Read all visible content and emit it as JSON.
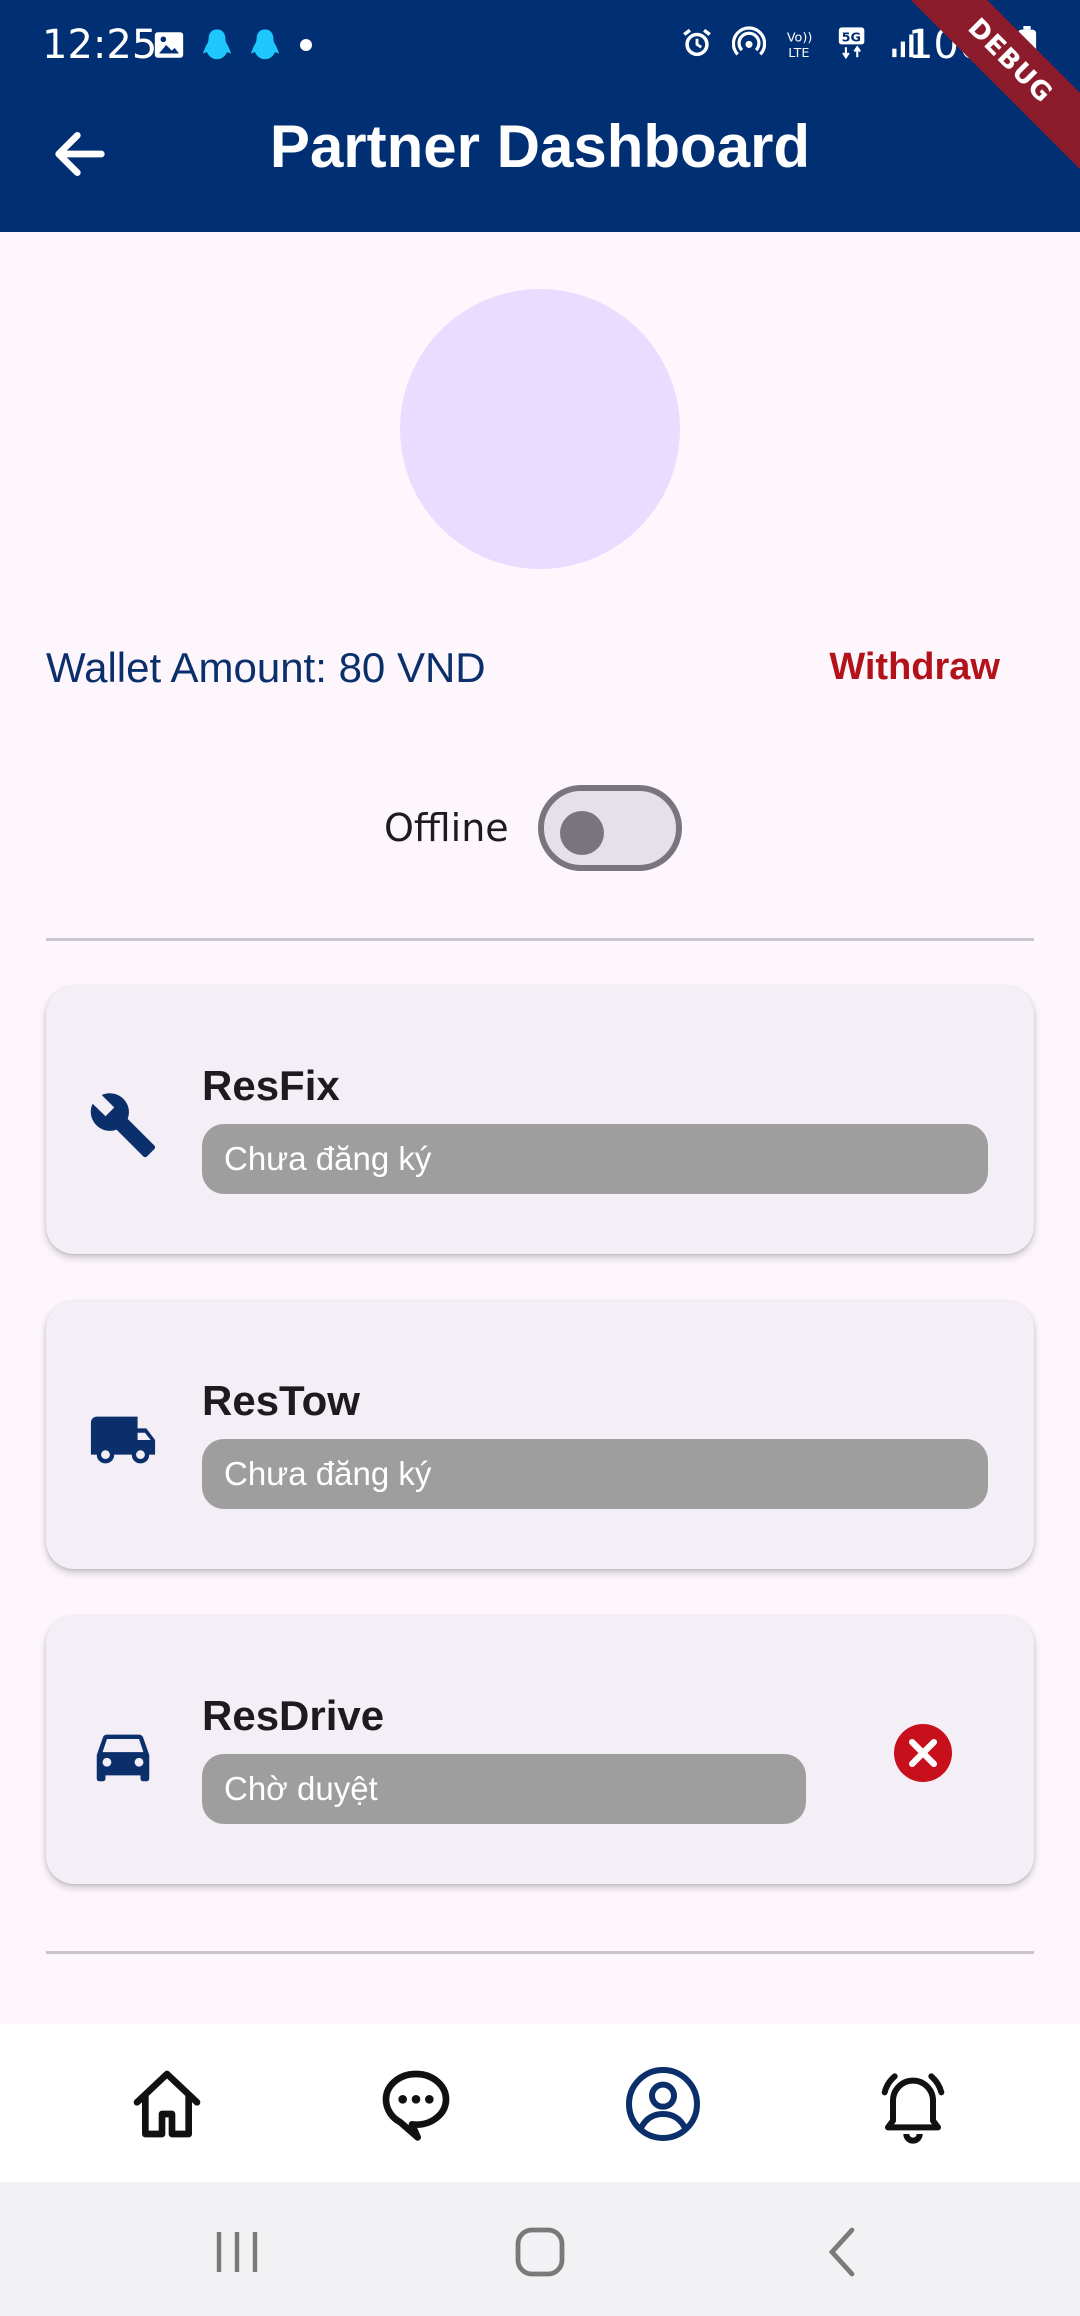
{
  "status_bar": {
    "time": "12:25",
    "battery": "100",
    "debug_label": "DEBUG"
  },
  "app_bar": {
    "title": "Partner Dashboard",
    "color": "#002f74"
  },
  "profile": {
    "avatar_color": "#e9ddff"
  },
  "wallet": {
    "amount_text": "Wallet Amount: 80 VND",
    "withdraw_label": "Withdraw"
  },
  "status_toggle": {
    "label": "Offline",
    "on": false
  },
  "services": [
    {
      "name": "ResFix",
      "status": "Chưa đăng ký",
      "icon": "wrench-icon"
    },
    {
      "name": "ResTow",
      "status": "Chưa đăng ký",
      "icon": "truck-icon"
    },
    {
      "name": "ResDrive",
      "status": "Chờ duyệt",
      "icon": "car-icon",
      "action_icon": "cancel-icon"
    }
  ],
  "bottom_nav": {
    "items": [
      "home-icon",
      "chat-icon",
      "profile-icon",
      "notification-bell-icon"
    ],
    "active": "profile-icon"
  },
  "system_nav": {
    "items": [
      "recent-apps-icon",
      "home-circle-icon",
      "back-chevron-icon"
    ]
  }
}
